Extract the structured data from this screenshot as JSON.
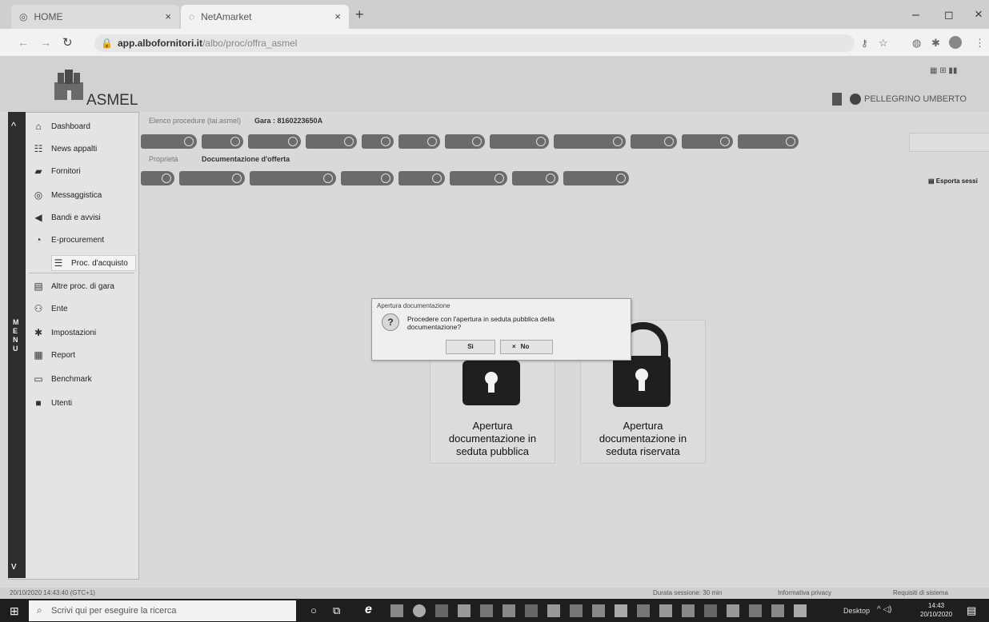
{
  "browser": {
    "tabs": [
      {
        "label": "HOME"
      },
      {
        "label": "NetAmarket"
      }
    ],
    "new_tab": "+",
    "url_host": "app.albofornitori.it",
    "url_path": "/albo/proc/offra_asmel",
    "window_controls": {
      "minimize": "–",
      "maximize": "◻",
      "close": "×"
    }
  },
  "app": {
    "logo_text": "ASMEL",
    "user_name": "PELLEGRINO UMBERTO",
    "export_label": "Esporta sessi",
    "breadcrumb": {
      "first": "Elenco procedure (tai.asmel)",
      "gara": "Gara : 8160223650A"
    },
    "sub_breadcrumb": {
      "first": "Proprietà",
      "current": "Documentazione d'offerta"
    },
    "sidebar_vertical_label": "MENU",
    "sidebar_items": [
      {
        "label": "Dashboard",
        "icon": "home-icon",
        "glyph": "⌂"
      },
      {
        "label": "News appalti",
        "icon": "news-icon",
        "glyph": "☷"
      },
      {
        "label": "Fornitori",
        "icon": "truck-icon",
        "glyph": "▰"
      },
      {
        "label": "Messaggistica",
        "icon": "message-icon",
        "glyph": "◎"
      },
      {
        "label": "Bandi e avvisi",
        "icon": "megaphone-icon",
        "glyph": "◀"
      },
      {
        "label": "E-procurement",
        "icon": "procurement-icon",
        "glyph": "◔"
      },
      {
        "label": "Proc. d'acquisto",
        "icon": "list-icon",
        "glyph": "☰"
      },
      {
        "label": "Altre proc. di gara",
        "icon": "folder-icon",
        "glyph": "▤"
      },
      {
        "label": "Ente",
        "icon": "people-icon",
        "glyph": "⚇"
      },
      {
        "label": "Impostazioni",
        "icon": "gear-icon",
        "glyph": "✱"
      },
      {
        "label": "Report",
        "icon": "chart-icon",
        "glyph": "▦"
      },
      {
        "label": "Benchmark",
        "icon": "document-icon",
        "glyph": "▭"
      },
      {
        "label": "Utenti",
        "icon": "user-icon",
        "glyph": "■"
      }
    ],
    "cards": [
      {
        "label_line1": "Apertura",
        "label_line2": "documentazione in",
        "label_line3": "seduta pubblica"
      },
      {
        "label_line1": "Apertura",
        "label_line2": "documentazione in",
        "label_line3": "seduta riservata"
      }
    ],
    "dialog": {
      "title": "Apertura documentazione",
      "message_line1": "Procedere con l'apertura in seduta pubblica della",
      "message_line2": "documentazione?",
      "yes": "Sì",
      "no": "No"
    },
    "status": {
      "timestamp": "20/10/2020 14:43:40 (GTC+1)",
      "session": "Durata sessione: 30 min",
      "privacy": "Informativa privacy",
      "requirements": "Requisiti di sistema"
    }
  },
  "taskbar": {
    "search_placeholder": "Scrivi qui per eseguire la ricerca",
    "desktop_label": "Desktop",
    "time": "14:43",
    "date": "20/10/2020"
  }
}
